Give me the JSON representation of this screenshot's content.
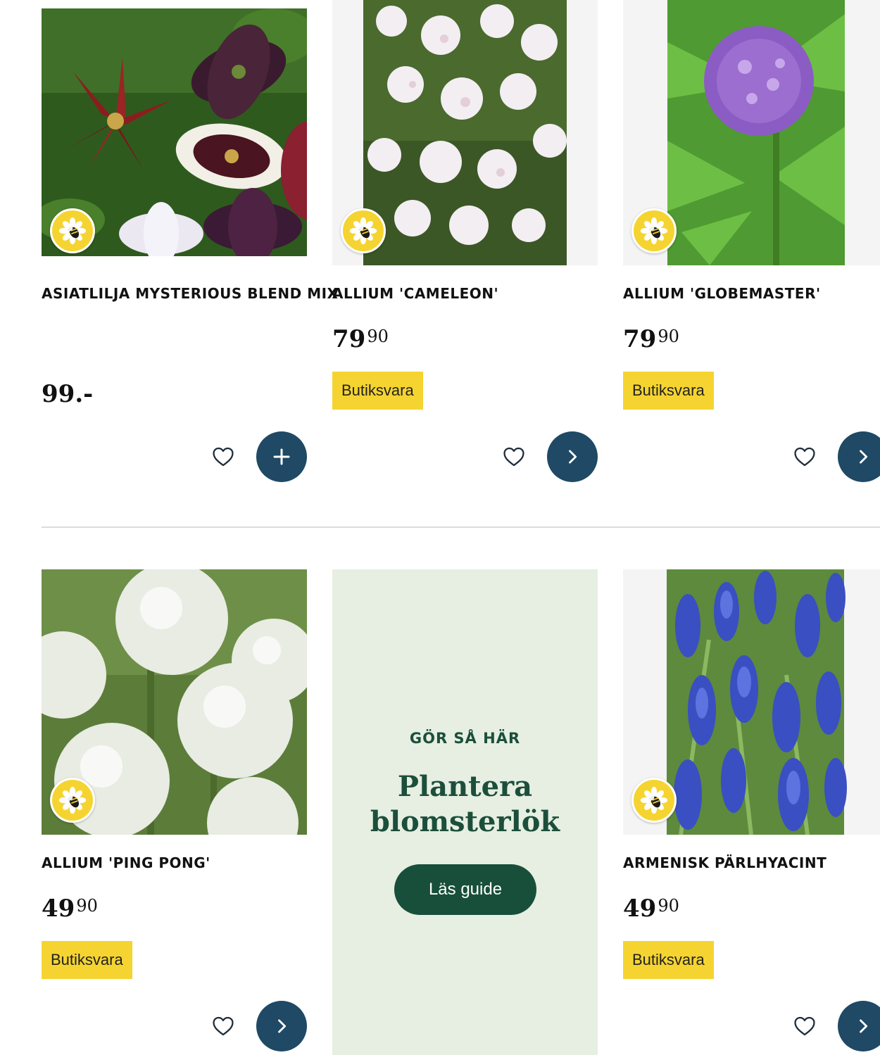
{
  "colors": {
    "badge": "#f5d431",
    "cta_button": "#1f4965",
    "guide_bg": "#e6efe2",
    "guide_accent": "#1c4f3b"
  },
  "products": [
    {
      "name": "ASIATLILJA MYSTERIOUS BLEND MIX",
      "price_flat": "99.-",
      "badge": "",
      "action_icon": "plus-icon"
    },
    {
      "name": "ALLIUM 'CAMELEON'",
      "price_main": "79",
      "price_dec": "90",
      "badge": "Butiksvara",
      "action_icon": "chevron-right-icon"
    },
    {
      "name": "ALLIUM 'GLOBEMASTER'",
      "price_main": "79",
      "price_dec": "90",
      "badge": "Butiksvara",
      "action_icon": "chevron-right-icon"
    },
    {
      "name": "ALLIUM 'PING PONG'",
      "price_main": "49",
      "price_dec": "90",
      "badge": "Butiksvara",
      "action_icon": "chevron-right-icon"
    },
    {
      "name": "ARMENISK PÄRLHYACINT",
      "price_main": "49",
      "price_dec": "90",
      "badge": "Butiksvara",
      "action_icon": "chevron-right-icon"
    }
  ],
  "guide": {
    "kicker": "GÖR SÅ HÄR",
    "title_line1": "Plantera",
    "title_line2": "blomsterlök",
    "button_label": "Läs guide"
  },
  "icons": {
    "bee_badge": "bee-flower-icon",
    "favorite": "heart-icon"
  }
}
